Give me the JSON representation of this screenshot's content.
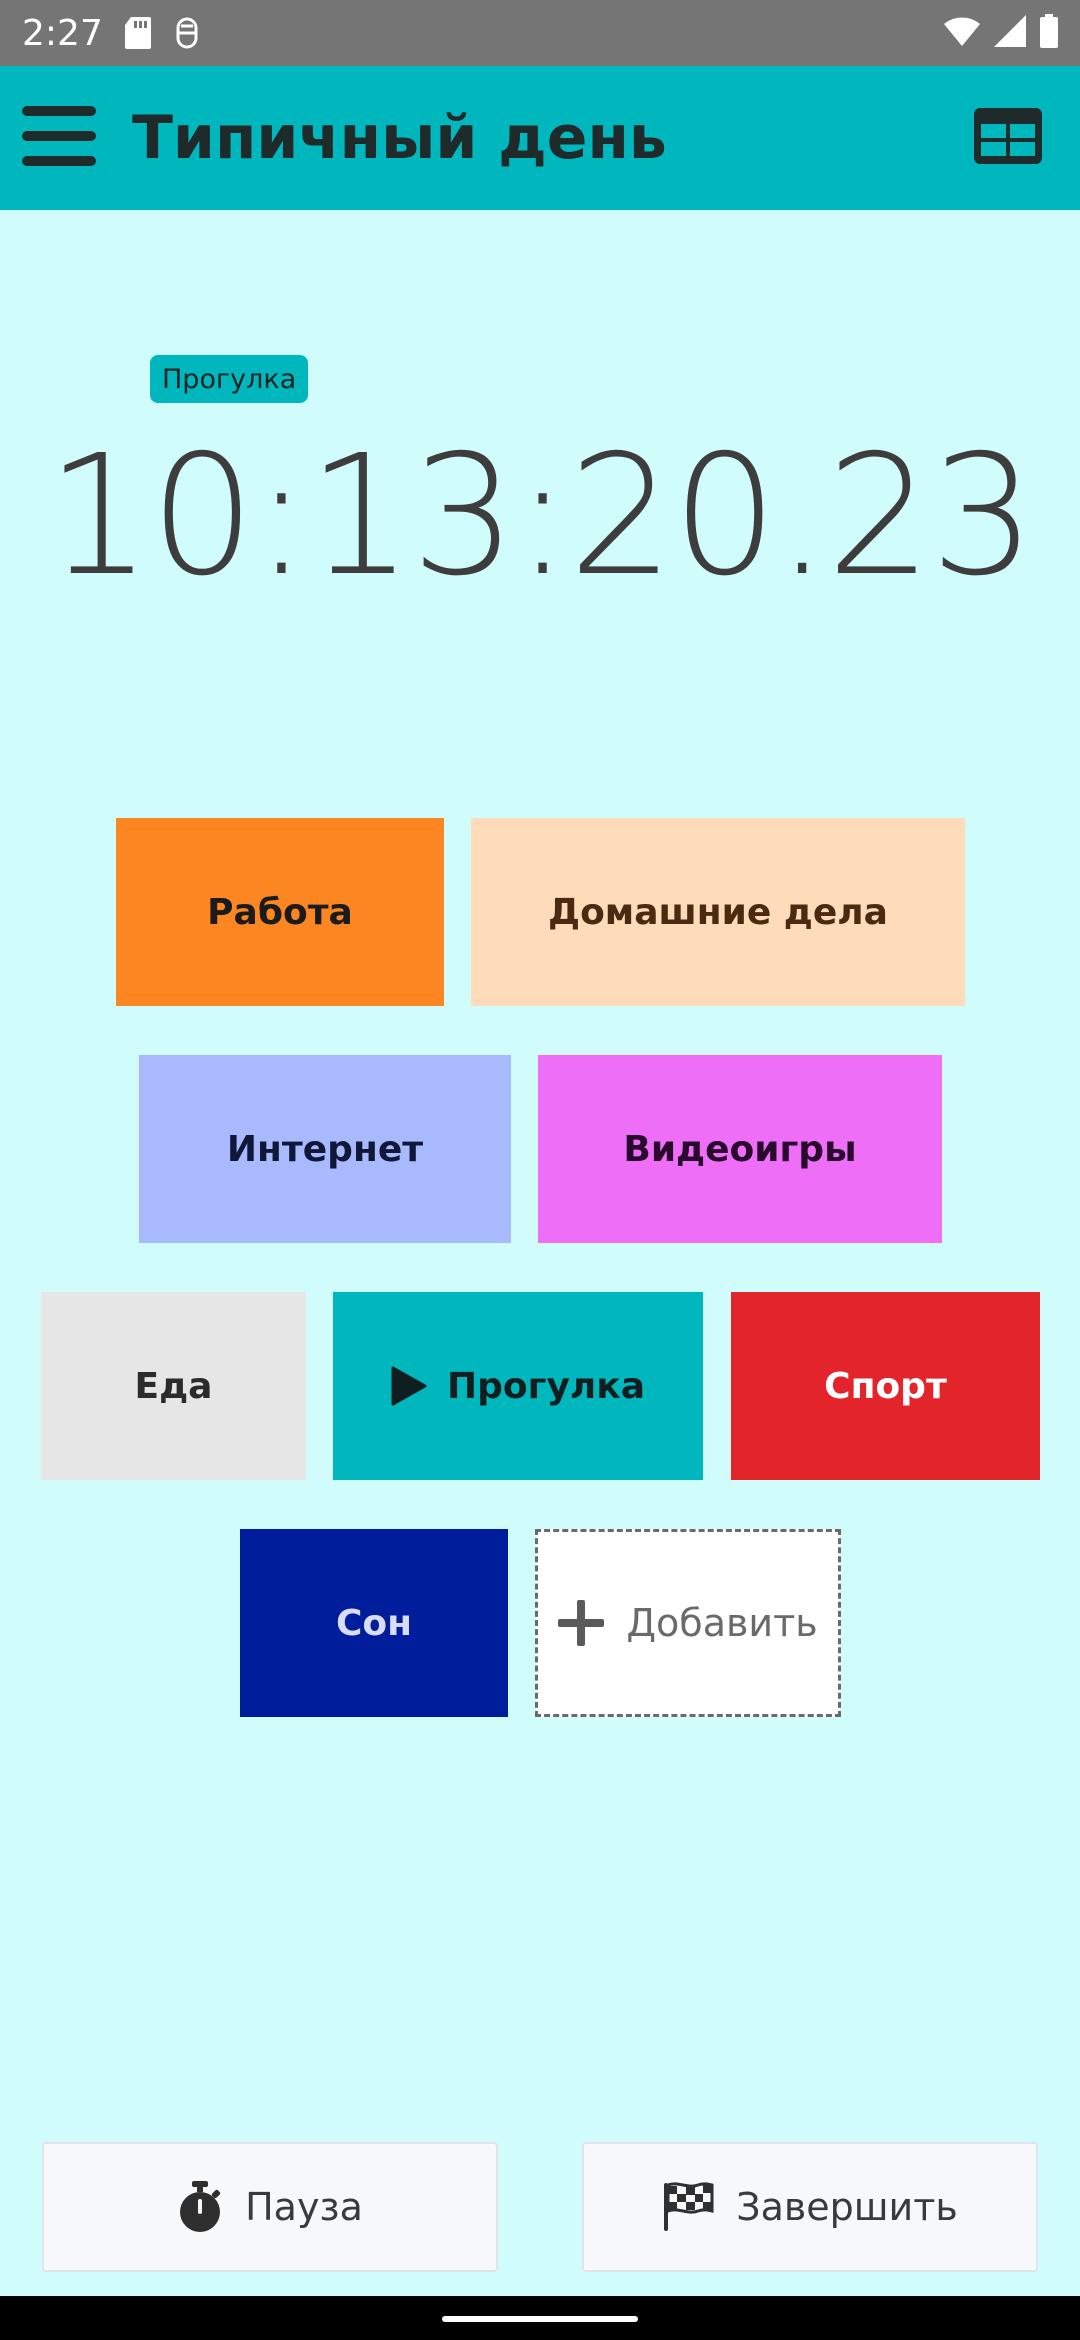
{
  "status_bar": {
    "time": "2:27",
    "icons": [
      "sd-card-icon",
      "debug-icon",
      "wifi-icon",
      "cell-signal-icon",
      "battery-icon"
    ]
  },
  "app_bar": {
    "title": "Типичный день",
    "menu_icon": "hamburger-menu-icon",
    "table_icon": "table-view-icon",
    "color": "#00b7bd"
  },
  "timer": {
    "current_activity": "Прогулка",
    "elapsed": "10:13:20.23"
  },
  "activities": [
    {
      "label": "Работа",
      "color": "#fc8621",
      "text_color": "#1b1b1b",
      "active": false
    },
    {
      "label": "Домашние дела",
      "color": "#fedbb9",
      "text_color": "#4a2a10",
      "active": false
    },
    {
      "label": "Интернет",
      "color": "#a8b9fd",
      "text_color": "#10183a",
      "active": false
    },
    {
      "label": "Видеоигры",
      "color": "#ee6ef8",
      "text_color": "#2a0a2c",
      "active": false
    },
    {
      "label": "Еда",
      "color": "#e6e6e6",
      "text_color": "#2b2b2b",
      "active": false
    },
    {
      "label": "Прогулка",
      "color": "#00b7bd",
      "text_color": "#0f1f1f",
      "active": true
    },
    {
      "label": "Спорт",
      "color": "#e3242b",
      "text_color": "#ffffff",
      "active": false
    },
    {
      "label": "Сон",
      "color": "#001e9b",
      "text_color": "#d8dcff",
      "active": false
    }
  ],
  "add_button": {
    "label": "Добавить",
    "icon": "plus-icon"
  },
  "bottom_actions": {
    "pause_label": "Пауза",
    "pause_icon": "stopwatch-icon",
    "finish_label": "Завершить",
    "finish_icon": "checkered-flag-icon"
  },
  "background_color": "#d0fcfc"
}
